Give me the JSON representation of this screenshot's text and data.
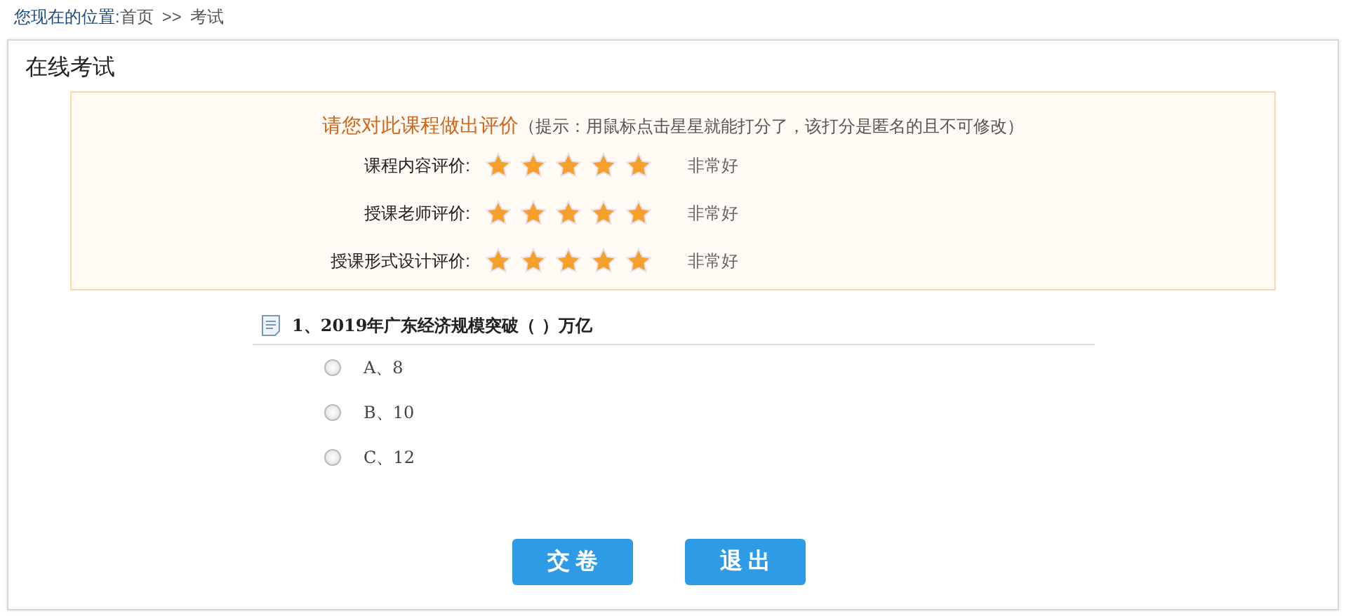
{
  "breadcrumb": {
    "label": "您现在的位置:",
    "items": [
      {
        "text": "首页",
        "kind": "link"
      },
      {
        "text": ">>",
        "kind": "separator"
      },
      {
        "text": "考试",
        "kind": "current"
      }
    ]
  },
  "panel": {
    "title": "在线考试"
  },
  "rating": {
    "heading": "请您对此课程做出评价",
    "hint": "（提示：用鼠标点击星星就能打分了，该打分是匿名的且不可修改）",
    "rows": [
      {
        "label": "课程内容评价:",
        "stars": 5,
        "reading": "非常好"
      },
      {
        "label": "授课老师评价:",
        "stars": 5,
        "reading": "非常好"
      },
      {
        "label": "授课形式设计评价:",
        "stars": 5,
        "reading": "非常好"
      }
    ]
  },
  "question": {
    "text": "1、2019年广东经济规模突破（  ）万亿",
    "options": [
      {
        "text": "A、8",
        "selected": false
      },
      {
        "text": "B、10",
        "selected": false
      },
      {
        "text": "C、12",
        "selected": false
      }
    ]
  },
  "buttons": [
    "交 卷",
    "退 出"
  ]
}
